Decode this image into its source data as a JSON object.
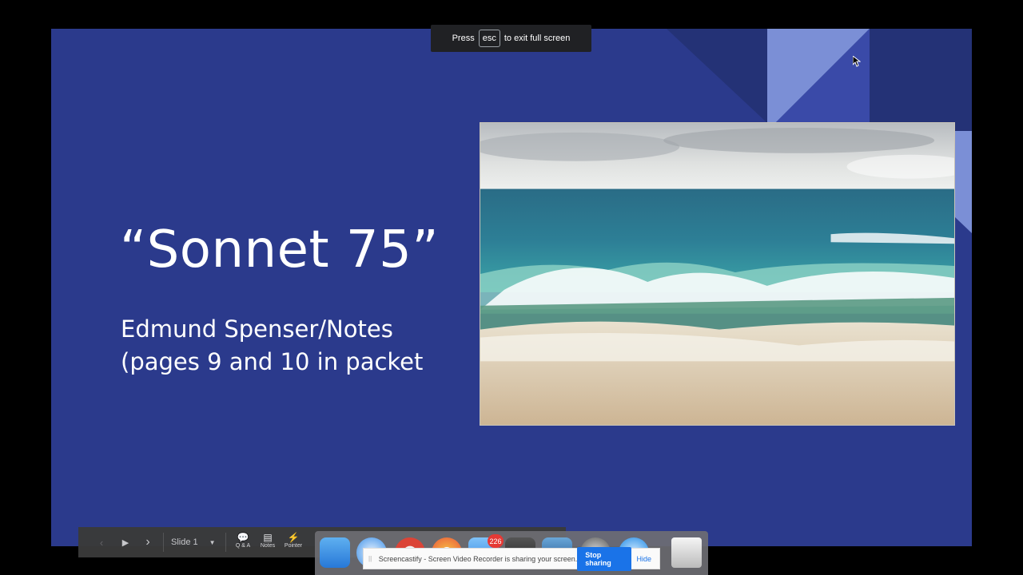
{
  "slide": {
    "title": "“Sonnet 75”",
    "subtitle_line1": "Edmund Spenser/Notes",
    "subtitle_line2": "(pages 9 and 10 in packet"
  },
  "fullscreen_banner": {
    "prefix": "Press",
    "key": "esc",
    "suffix": "to exit full screen"
  },
  "toolbar": {
    "slide_selector": "Slide 1",
    "qa_label": "Q & A",
    "notes_label": "Notes",
    "pointer_label": "Pointer"
  },
  "dock": {
    "mail_badge": "226"
  },
  "share_bar": {
    "message": "Screencastify - Screen Video Recorder is sharing your screen.",
    "stop_label": "Stop sharing",
    "hide_label": "Hide"
  },
  "colors": {
    "slide_bg": "#2b3a8c",
    "accent_blue": "#1a73e8"
  }
}
